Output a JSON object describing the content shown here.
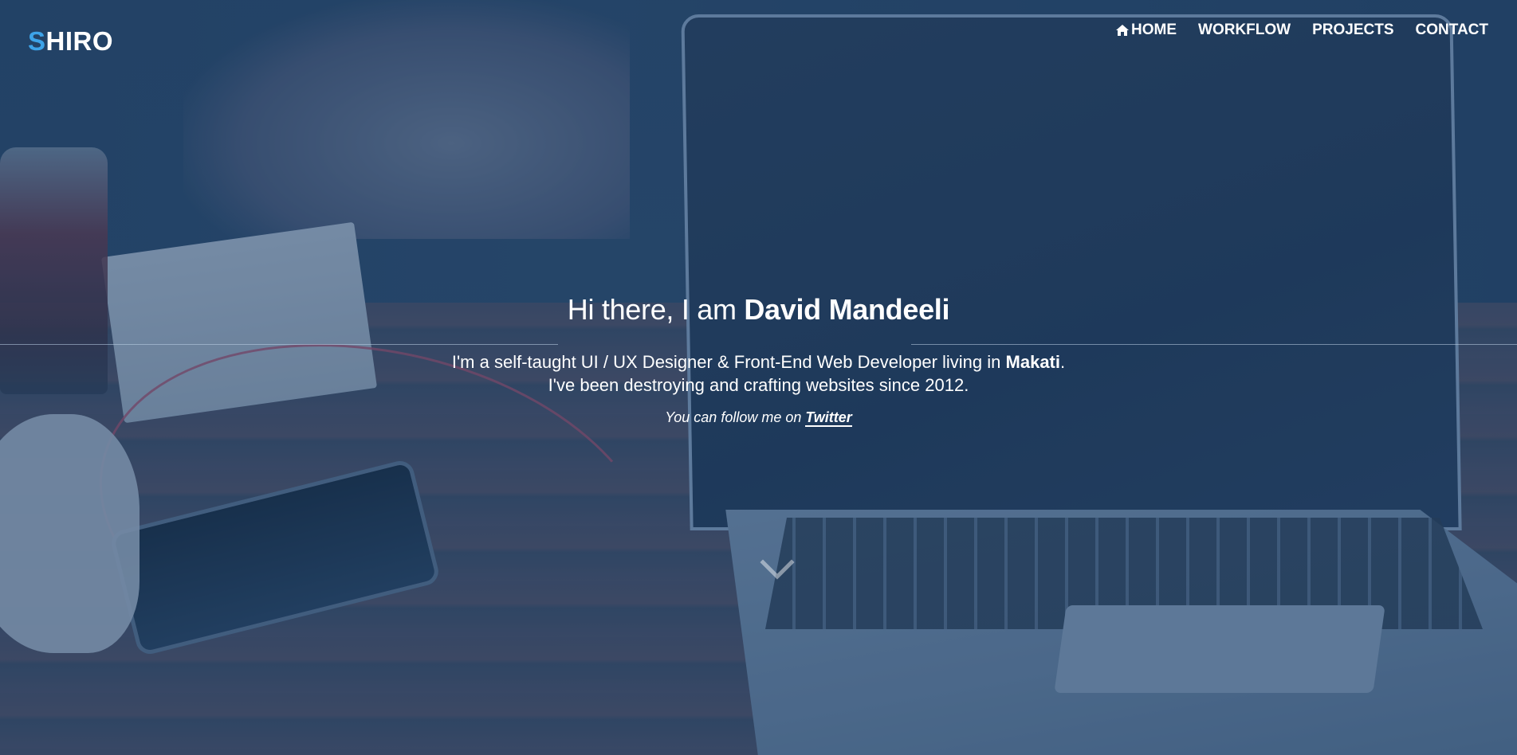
{
  "brand": {
    "first_letter": "S",
    "rest": "HIRO",
    "accent_color": "#3da3e8"
  },
  "nav": {
    "items": [
      {
        "label": "HOME",
        "icon": "home-icon"
      },
      {
        "label": "WORKFLOW"
      },
      {
        "label": "PROJECTS"
      },
      {
        "label": "CONTACT"
      }
    ]
  },
  "hero": {
    "greeting": "Hi there, I am",
    "name": "David Mandeeli",
    "desc_line1_prefix": "I'm a self-taught UI / UX Designer & Front-End Web Developer living in",
    "city": "Makati",
    "desc_line1_suffix": ".",
    "desc_line2": "I've been destroying and crafting websites since 2012.",
    "follow_prefix": "You can follow me on",
    "follow_link": "Twitter"
  },
  "scroll_icon": "chevron-down-icon"
}
